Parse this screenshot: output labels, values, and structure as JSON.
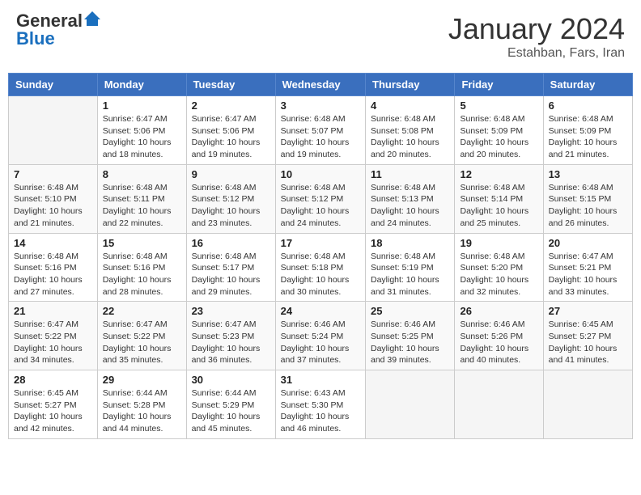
{
  "header": {
    "logo_general": "General",
    "logo_blue": "Blue",
    "title": "January 2024",
    "location": "Estahban, Fars, Iran"
  },
  "days_of_week": [
    "Sunday",
    "Monday",
    "Tuesday",
    "Wednesday",
    "Thursday",
    "Friday",
    "Saturday"
  ],
  "weeks": [
    [
      {
        "day": "",
        "info": ""
      },
      {
        "day": "1",
        "info": "Sunrise: 6:47 AM\nSunset: 5:06 PM\nDaylight: 10 hours and 18 minutes."
      },
      {
        "day": "2",
        "info": "Sunrise: 6:47 AM\nSunset: 5:06 PM\nDaylight: 10 hours and 19 minutes."
      },
      {
        "day": "3",
        "info": "Sunrise: 6:48 AM\nSunset: 5:07 PM\nDaylight: 10 hours and 19 minutes."
      },
      {
        "day": "4",
        "info": "Sunrise: 6:48 AM\nSunset: 5:08 PM\nDaylight: 10 hours and 20 minutes."
      },
      {
        "day": "5",
        "info": "Sunrise: 6:48 AM\nSunset: 5:09 PM\nDaylight: 10 hours and 20 minutes."
      },
      {
        "day": "6",
        "info": "Sunrise: 6:48 AM\nSunset: 5:09 PM\nDaylight: 10 hours and 21 minutes."
      }
    ],
    [
      {
        "day": "7",
        "info": "Sunrise: 6:48 AM\nSunset: 5:10 PM\nDaylight: 10 hours and 21 minutes."
      },
      {
        "day": "8",
        "info": "Sunrise: 6:48 AM\nSunset: 5:11 PM\nDaylight: 10 hours and 22 minutes."
      },
      {
        "day": "9",
        "info": "Sunrise: 6:48 AM\nSunset: 5:12 PM\nDaylight: 10 hours and 23 minutes."
      },
      {
        "day": "10",
        "info": "Sunrise: 6:48 AM\nSunset: 5:12 PM\nDaylight: 10 hours and 24 minutes."
      },
      {
        "day": "11",
        "info": "Sunrise: 6:48 AM\nSunset: 5:13 PM\nDaylight: 10 hours and 24 minutes."
      },
      {
        "day": "12",
        "info": "Sunrise: 6:48 AM\nSunset: 5:14 PM\nDaylight: 10 hours and 25 minutes."
      },
      {
        "day": "13",
        "info": "Sunrise: 6:48 AM\nSunset: 5:15 PM\nDaylight: 10 hours and 26 minutes."
      }
    ],
    [
      {
        "day": "14",
        "info": "Sunrise: 6:48 AM\nSunset: 5:16 PM\nDaylight: 10 hours and 27 minutes."
      },
      {
        "day": "15",
        "info": "Sunrise: 6:48 AM\nSunset: 5:16 PM\nDaylight: 10 hours and 28 minutes."
      },
      {
        "day": "16",
        "info": "Sunrise: 6:48 AM\nSunset: 5:17 PM\nDaylight: 10 hours and 29 minutes."
      },
      {
        "day": "17",
        "info": "Sunrise: 6:48 AM\nSunset: 5:18 PM\nDaylight: 10 hours and 30 minutes."
      },
      {
        "day": "18",
        "info": "Sunrise: 6:48 AM\nSunset: 5:19 PM\nDaylight: 10 hours and 31 minutes."
      },
      {
        "day": "19",
        "info": "Sunrise: 6:48 AM\nSunset: 5:20 PM\nDaylight: 10 hours and 32 minutes."
      },
      {
        "day": "20",
        "info": "Sunrise: 6:47 AM\nSunset: 5:21 PM\nDaylight: 10 hours and 33 minutes."
      }
    ],
    [
      {
        "day": "21",
        "info": "Sunrise: 6:47 AM\nSunset: 5:22 PM\nDaylight: 10 hours and 34 minutes."
      },
      {
        "day": "22",
        "info": "Sunrise: 6:47 AM\nSunset: 5:22 PM\nDaylight: 10 hours and 35 minutes."
      },
      {
        "day": "23",
        "info": "Sunrise: 6:47 AM\nSunset: 5:23 PM\nDaylight: 10 hours and 36 minutes."
      },
      {
        "day": "24",
        "info": "Sunrise: 6:46 AM\nSunset: 5:24 PM\nDaylight: 10 hours and 37 minutes."
      },
      {
        "day": "25",
        "info": "Sunrise: 6:46 AM\nSunset: 5:25 PM\nDaylight: 10 hours and 39 minutes."
      },
      {
        "day": "26",
        "info": "Sunrise: 6:46 AM\nSunset: 5:26 PM\nDaylight: 10 hours and 40 minutes."
      },
      {
        "day": "27",
        "info": "Sunrise: 6:45 AM\nSunset: 5:27 PM\nDaylight: 10 hours and 41 minutes."
      }
    ],
    [
      {
        "day": "28",
        "info": "Sunrise: 6:45 AM\nSunset: 5:27 PM\nDaylight: 10 hours and 42 minutes."
      },
      {
        "day": "29",
        "info": "Sunrise: 6:44 AM\nSunset: 5:28 PM\nDaylight: 10 hours and 44 minutes."
      },
      {
        "day": "30",
        "info": "Sunrise: 6:44 AM\nSunset: 5:29 PM\nDaylight: 10 hours and 45 minutes."
      },
      {
        "day": "31",
        "info": "Sunrise: 6:43 AM\nSunset: 5:30 PM\nDaylight: 10 hours and 46 minutes."
      },
      {
        "day": "",
        "info": ""
      },
      {
        "day": "",
        "info": ""
      },
      {
        "day": "",
        "info": ""
      }
    ]
  ]
}
